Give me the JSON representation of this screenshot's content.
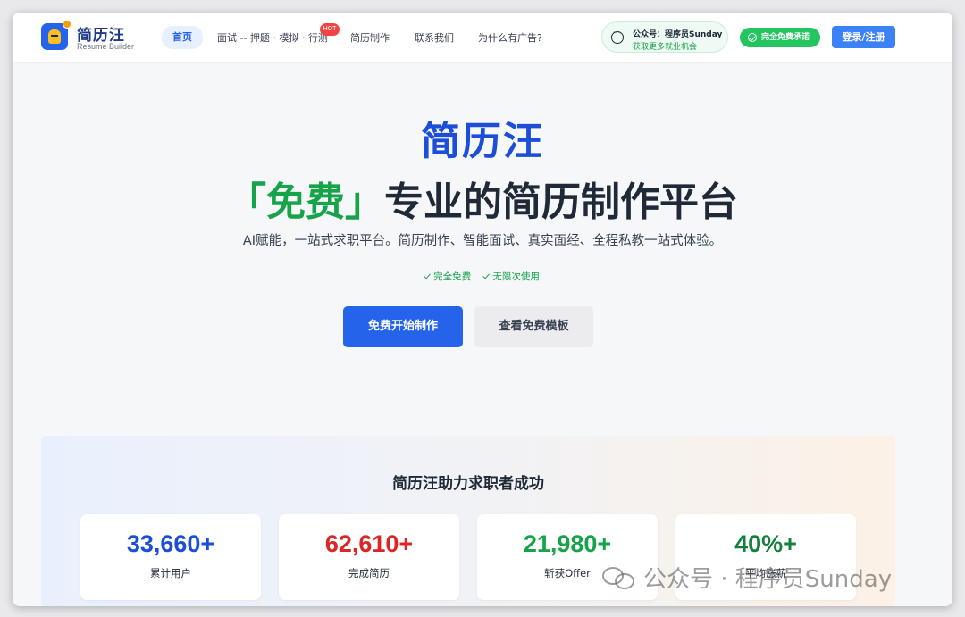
{
  "brand": {
    "name": "简历汪",
    "subtitle": "Resume Builder"
  },
  "nav": {
    "items": [
      {
        "label": "首页"
      },
      {
        "label": "面试 -- 押题 · 模拟 · 行测"
      },
      {
        "label": "简历制作"
      },
      {
        "label": "联系我们"
      },
      {
        "label": "为什么有广告?"
      }
    ],
    "hot_badge": "HOT"
  },
  "wechat": {
    "title": "公众号：程序员Sunday",
    "subtitle": "获取更多就业机会"
  },
  "free_pill": "完全免费承诺",
  "login_button": "登录/注册",
  "hero": {
    "title": "简历汪",
    "subtitle_highlight": "「免费」",
    "subtitle_rest": "专业的简历制作平台",
    "description": "AI赋能，一站式求职平台。简历制作、智能面试、真实面经、全程私教一站式体验。",
    "ticks": [
      "完全免费",
      "无限次使用"
    ],
    "primary_cta": "免费开始制作",
    "secondary_cta": "查看免费模板"
  },
  "stats": {
    "title": "简历汪助力求职者成功",
    "items": [
      {
        "value": "33,660+",
        "label": "累计用户",
        "color": "#1d4ed8"
      },
      {
        "value": "62,610+",
        "label": "完成简历",
        "color": "#dc2626"
      },
      {
        "value": "21,980+",
        "label": "斩获Offer",
        "color": "#16a34a"
      },
      {
        "value": "40%+",
        "label": "平均涨薪",
        "color": "#15803d"
      }
    ]
  },
  "watermark": "公众号 · 程序员Sunday",
  "colors": {
    "primary": "#2563eb",
    "green": "#16a34a",
    "hot": "#ef4444"
  }
}
